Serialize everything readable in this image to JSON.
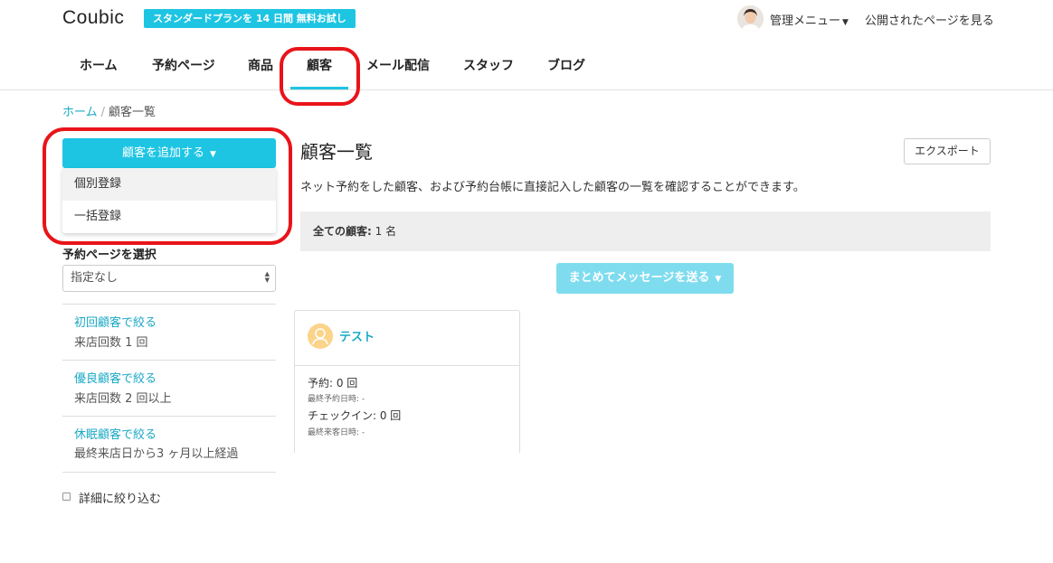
{
  "header": {
    "logo": "Coubic",
    "trial_badge": "スタンダードプランを 14 日間 無料お試し",
    "admin_menu": "管理メニュー",
    "public_page_link": "公開されたページを見る"
  },
  "nav": {
    "items": [
      {
        "label": "ホーム"
      },
      {
        "label": "予約ページ"
      },
      {
        "label": "商品"
      },
      {
        "label": "顧客",
        "active": true
      },
      {
        "label": "メール配信"
      },
      {
        "label": "スタッフ"
      },
      {
        "label": "ブログ"
      }
    ]
  },
  "breadcrumb": {
    "home": "ホーム",
    "separator": "/",
    "current": "顧客一覧"
  },
  "sidebar": {
    "add_button": "顧客を追加する",
    "dropdown": [
      "個別登録",
      "一括登録"
    ],
    "select_label": "予約ページを選択",
    "select_value": "指定なし",
    "filters": [
      {
        "link": "初回顧客で絞る",
        "desc": "来店回数 1 回"
      },
      {
        "link": "優良顧客で絞る",
        "desc": "来店回数 2 回以上"
      },
      {
        "link": "休眠顧客で絞る",
        "desc": "最終来店日から3 ヶ月以上経過"
      }
    ],
    "detail_filter": "詳細に絞り込む"
  },
  "main": {
    "title": "顧客一覧",
    "export_button": "エクスポート",
    "description": "ネット予約をした顧客、および予約台帳に直接記入した顧客の一覧を確認することができます。",
    "summary_label": "全ての顧客:",
    "summary_value": "1 名",
    "bulk_message_button": "まとめてメッセージを送る",
    "customer_card": {
      "name": "テスト",
      "reservations": "予約: 0 回",
      "last_reservation": "最終予約日時: -",
      "checkins": "チェックイン: 0 回",
      "last_visit": "最終来客日時: -"
    }
  },
  "colors": {
    "accent": "#1ec5e3",
    "link": "#1aa9c6",
    "annotation": "#e8141a"
  }
}
